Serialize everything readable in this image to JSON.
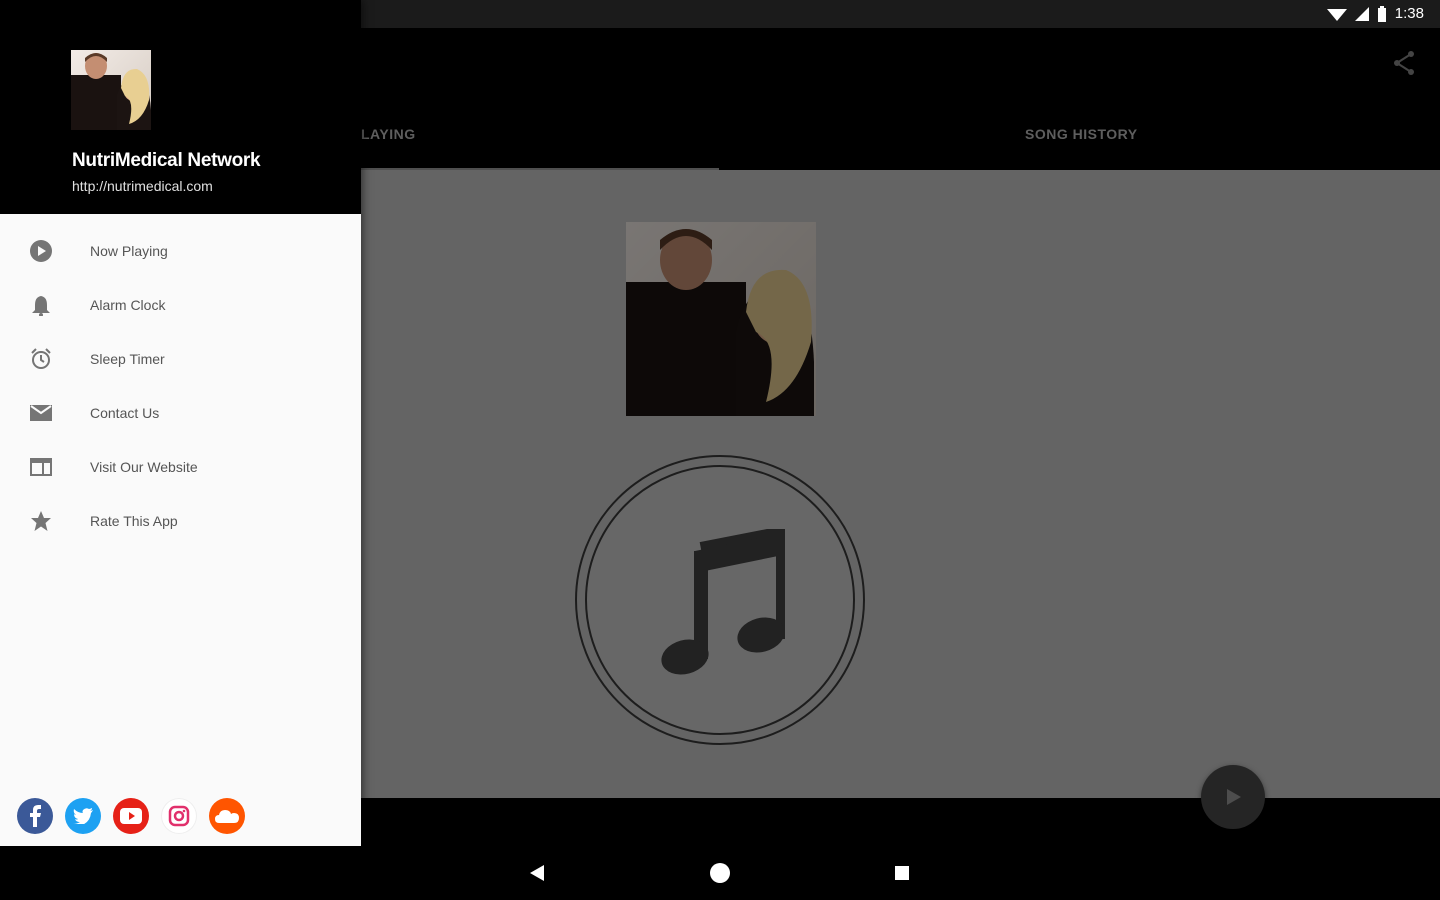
{
  "status_bar": {
    "time": "1:38"
  },
  "tabs": [
    {
      "label": "LAYING"
    },
    {
      "label": "SONG HISTORY"
    }
  ],
  "drawer": {
    "station_name": "NutriMedical Network",
    "station_url": "http://nutrimedical.com",
    "menu": [
      {
        "label": "Now Playing",
        "icon": "play-circle-icon"
      },
      {
        "label": "Alarm Clock",
        "icon": "bell-icon"
      },
      {
        "label": "Sleep Timer",
        "icon": "alarm-clock-icon"
      },
      {
        "label": "Contact Us",
        "icon": "envelope-icon"
      },
      {
        "label": "Visit Our Website",
        "icon": "web-browser-icon"
      },
      {
        "label": "Rate This App",
        "icon": "star-icon"
      }
    ],
    "social": [
      {
        "name": "facebook-icon",
        "color": "#3b5998"
      },
      {
        "name": "twitter-icon",
        "color": "#1da1f2"
      },
      {
        "name": "youtube-icon",
        "color": "#e62117"
      },
      {
        "name": "instagram-icon",
        "color": "#e1306c"
      },
      {
        "name": "soundcloud-icon",
        "color": "#ff5500"
      }
    ]
  }
}
